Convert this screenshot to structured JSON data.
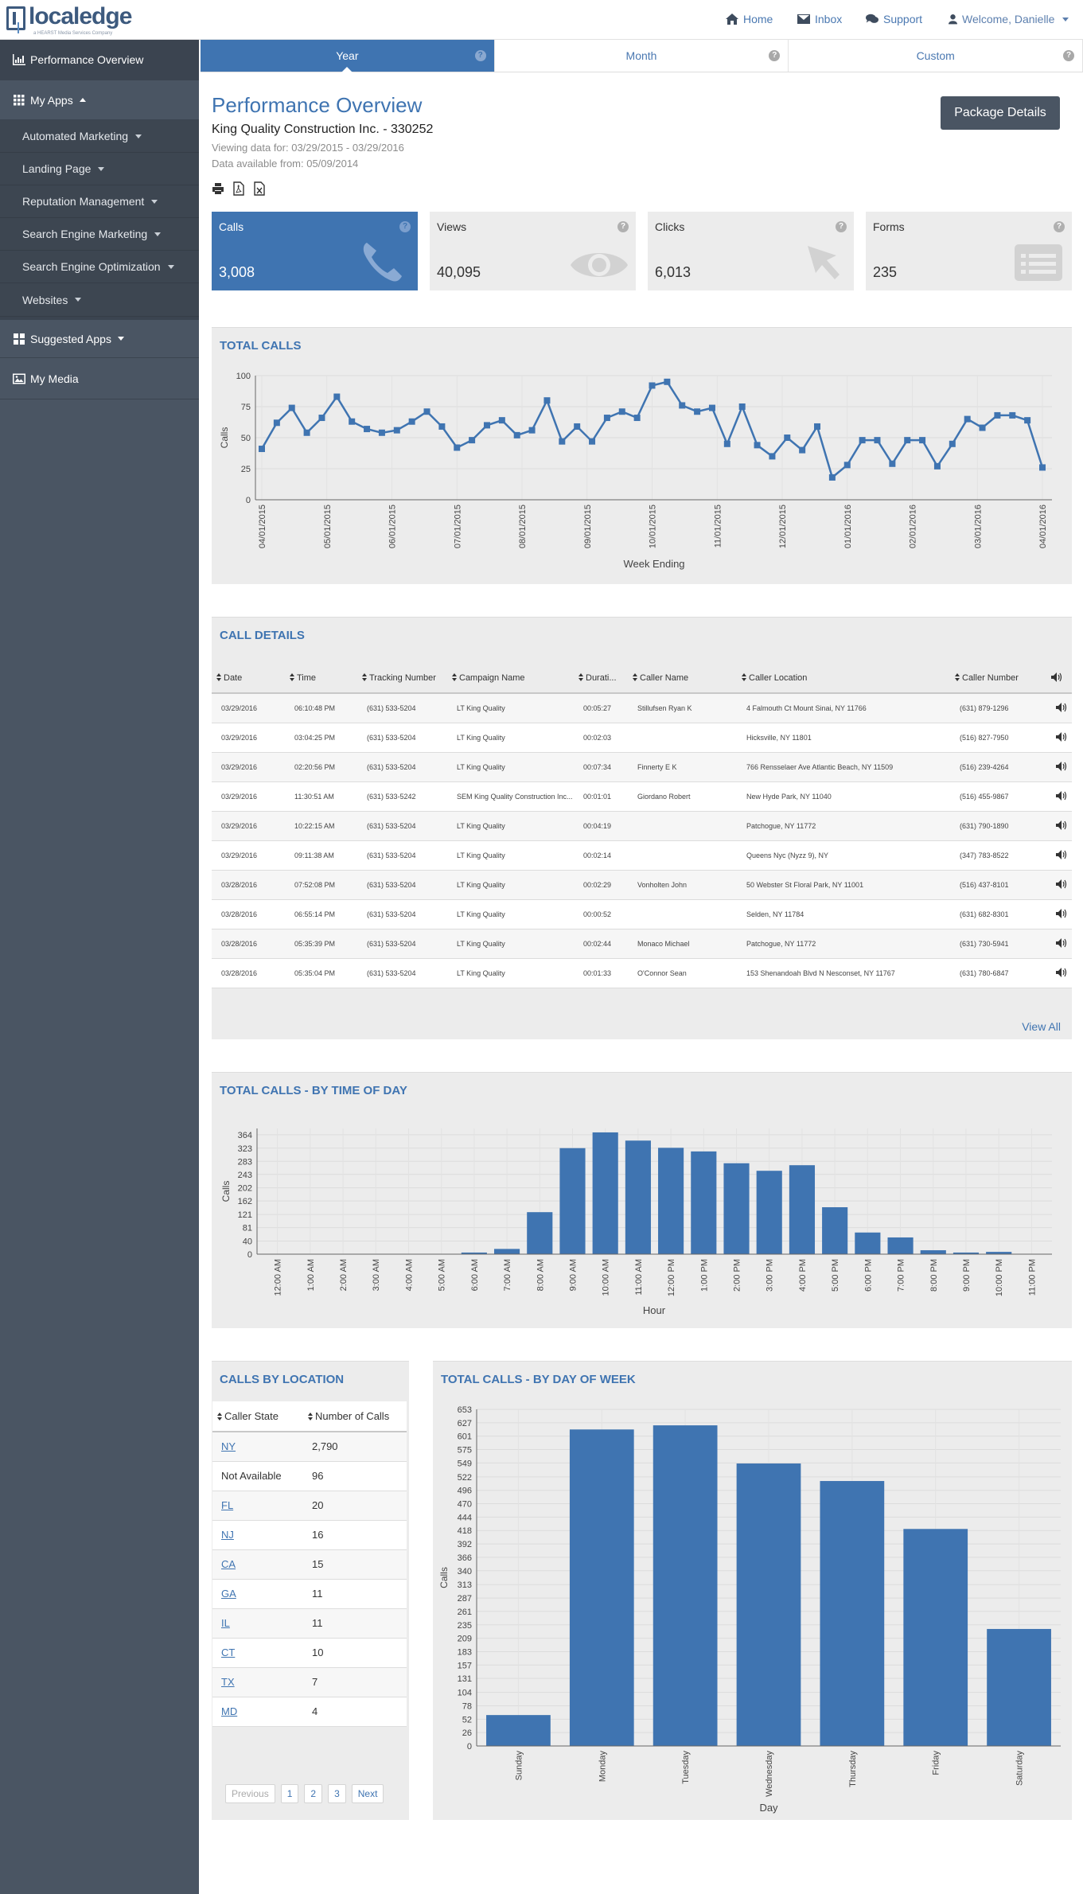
{
  "brand": {
    "logo": "localedge",
    "sub": "a HEARST Media Services Company"
  },
  "topnav": {
    "home": "Home",
    "inbox": "Inbox",
    "support": "Support",
    "welcome": "Welcome, Danielle"
  },
  "sidebar": {
    "performance": "Performance Overview",
    "my_apps": "My Apps",
    "apps": [
      "Automated Marketing",
      "Landing Page",
      "Reputation Management",
      "Search Engine Marketing",
      "Search Engine Optimization",
      "Websites"
    ],
    "suggested": "Suggested Apps",
    "media": "My Media"
  },
  "tabs": [
    "Year",
    "Month",
    "Custom"
  ],
  "header": {
    "title": "Performance Overview",
    "company": "King Quality Construction Inc. - 330252",
    "viewing": "Viewing data for: 03/29/2015 - 03/29/2016",
    "available": "Data available from: 05/09/2014",
    "package_button": "Package Details"
  },
  "stats": [
    {
      "label": "Calls",
      "value": "3,008",
      "icon": "phone-icon"
    },
    {
      "label": "Views",
      "value": "40,095",
      "icon": "eye-icon"
    },
    {
      "label": "Clicks",
      "value": "6,013",
      "icon": "cursor-icon"
    },
    {
      "label": "Forms",
      "value": "235",
      "icon": "form-icon"
    }
  ],
  "total_calls": {
    "title": "TOTAL CALLS",
    "xlabel": "Week Ending",
    "ylabel": "Calls",
    "xticks": [
      "04/01/2015",
      "05/01/2015",
      "06/01/2015",
      "07/01/2015",
      "08/01/2015",
      "09/01/2015",
      "10/01/2015",
      "11/01/2015",
      "12/01/2015",
      "01/01/2016",
      "02/01/2016",
      "03/01/2016",
      "04/01/2016"
    ],
    "yticks": [
      "0",
      "25",
      "50",
      "75",
      "100"
    ]
  },
  "call_details": {
    "title": "CALL DETAILS",
    "columns": [
      "Date",
      "Time",
      "Tracking Number",
      "Campaign Name",
      "Durati...",
      "Caller Name",
      "Caller Location",
      "Caller Number"
    ],
    "rows": [
      [
        "03/29/2016",
        "06:10:48 PM",
        "(631) 533-5204",
        "LT King Quality",
        "00:05:27",
        "Stillufsen Ryan K",
        "4 Falmouth Ct Mount Sinai, NY 11766",
        "(631) 879-1296"
      ],
      [
        "03/29/2016",
        "03:04:25 PM",
        "(631) 533-5204",
        "LT King Quality",
        "00:02:03",
        "",
        "Hicksville, NY 11801",
        "(516) 827-7950"
      ],
      [
        "03/29/2016",
        "02:20:56 PM",
        "(631) 533-5204",
        "LT King Quality",
        "00:07:34",
        "Finnerty E K",
        "766 Rensselaer Ave Atlantic Beach, NY 11509",
        "(516) 239-4264"
      ],
      [
        "03/29/2016",
        "11:30:51 AM",
        "(631) 533-5242",
        "SEM King Quality Construction Inc...",
        "00:01:01",
        "Giordano Robert",
        "New Hyde Park, NY 11040",
        "(516) 455-9867"
      ],
      [
        "03/29/2016",
        "10:22:15 AM",
        "(631) 533-5204",
        "LT King Quality",
        "00:04:19",
        "",
        "Patchogue, NY 11772",
        "(631) 790-1890"
      ],
      [
        "03/29/2016",
        "09:11:38 AM",
        "(631) 533-5204",
        "LT King Quality",
        "00:02:14",
        "",
        "Queens Nyc (Nyzz 9), NY",
        "(347) 783-8522"
      ],
      [
        "03/28/2016",
        "07:52:08 PM",
        "(631) 533-5204",
        "LT King Quality",
        "00:02:29",
        "Vonholten John",
        "50 Webster St Floral Park, NY 11001",
        "(516) 437-8101"
      ],
      [
        "03/28/2016",
        "06:55:14 PM",
        "(631) 533-5204",
        "LT King Quality",
        "00:00:52",
        "",
        "Selden, NY 11784",
        "(631) 682-8301"
      ],
      [
        "03/28/2016",
        "05:35:39 PM",
        "(631) 533-5204",
        "LT King Quality",
        "00:02:44",
        "Monaco Michael",
        "Patchogue, NY 11772",
        "(631) 730-5941"
      ],
      [
        "03/28/2016",
        "05:35:04 PM",
        "(631) 533-5204",
        "LT King Quality",
        "00:01:33",
        "O'Connor Sean",
        "153 Shenandoah Blvd N Nesconset, NY 11767",
        "(631) 780-6847"
      ]
    ],
    "view_all": "View All"
  },
  "by_location": {
    "title": "CALLS BY LOCATION",
    "columns": [
      "Caller State",
      "Number of Calls"
    ],
    "rows": [
      {
        "state": "NY",
        "calls": "2,790",
        "link": true
      },
      {
        "state": "Not Available",
        "calls": "96",
        "link": false
      },
      {
        "state": "FL",
        "calls": "20",
        "link": true
      },
      {
        "state": "NJ",
        "calls": "16",
        "link": true
      },
      {
        "state": "CA",
        "calls": "15",
        "link": true
      },
      {
        "state": "GA",
        "calls": "11",
        "link": true
      },
      {
        "state": "IL",
        "calls": "11",
        "link": true
      },
      {
        "state": "CT",
        "calls": "10",
        "link": true
      },
      {
        "state": "TX",
        "calls": "7",
        "link": true
      },
      {
        "state": "MD",
        "calls": "4",
        "link": true
      }
    ],
    "pager": {
      "prev": "Previous",
      "pages": [
        "1",
        "2",
        "3"
      ],
      "next": "Next"
    }
  },
  "chart_data": [
    {
      "type": "line",
      "title": "TOTAL CALLS",
      "xlabel": "Week Ending",
      "ylabel": "Calls",
      "ylim": [
        0,
        100
      ],
      "x_ticks": [
        "04/01/2015",
        "05/01/2015",
        "06/01/2015",
        "07/01/2015",
        "08/01/2015",
        "09/01/2015",
        "10/01/2015",
        "11/01/2015",
        "12/01/2015",
        "01/01/2016",
        "02/01/2016",
        "03/01/2016",
        "04/01/2016"
      ],
      "series": [
        {
          "values": [
            41,
            62,
            74,
            54,
            66,
            83,
            63,
            57,
            54,
            56,
            63,
            71,
            59,
            42,
            48,
            60,
            64,
            52,
            56,
            80,
            47,
            59,
            47,
            66,
            71,
            66,
            92,
            95,
            76,
            71,
            74,
            45,
            75,
            44,
            35,
            50,
            40,
            59,
            18,
            28,
            48,
            48,
            29,
            48,
            48,
            27,
            45,
            65,
            58,
            68,
            68,
            64,
            26
          ]
        }
      ]
    },
    {
      "type": "bar",
      "title": "TOTAL CALLS - BY TIME OF DAY",
      "xlabel": "Hour",
      "ylabel": "Calls",
      "ylim": [
        0,
        383
      ],
      "y_ticks": [
        0,
        40,
        81,
        121,
        162,
        202,
        243,
        283,
        323,
        364
      ],
      "categories": [
        "12:00 AM",
        "1:00 AM",
        "2:00 AM",
        "3:00 AM",
        "4:00 AM",
        "5:00 AM",
        "6:00 AM",
        "7:00 AM",
        "8:00 AM",
        "9:00 AM",
        "10:00 AM",
        "11:00 AM",
        "12:00 PM",
        "1:00 PM",
        "2:00 PM",
        "3:00 PM",
        "4:00 PM",
        "5:00 PM",
        "6:00 PM",
        "7:00 PM",
        "8:00 PM",
        "9:00 PM",
        "10:00 PM",
        "11:00 PM"
      ],
      "values": [
        0,
        0,
        0,
        0,
        0,
        0,
        5,
        16,
        128,
        323,
        371,
        346,
        324,
        313,
        277,
        254,
        271,
        143,
        66,
        51,
        12,
        5,
        7,
        0
      ]
    },
    {
      "type": "bar",
      "title": "TOTAL CALLS - BY DAY OF WEEK",
      "xlabel": "Day",
      "ylabel": "Calls",
      "ylim": [
        0,
        653
      ],
      "y_ticks": [
        0,
        26,
        52,
        78,
        104,
        131,
        157,
        183,
        209,
        235,
        261,
        287,
        313,
        340,
        366,
        392,
        418,
        444,
        470,
        496,
        522,
        549,
        575,
        601,
        627,
        653
      ],
      "categories": [
        "Sunday",
        "Monday",
        "Tuesday",
        "Wednesday",
        "Thursday",
        "Friday",
        "Saturday"
      ],
      "values": [
        60,
        614,
        622,
        548,
        514,
        421,
        227
      ]
    }
  ]
}
